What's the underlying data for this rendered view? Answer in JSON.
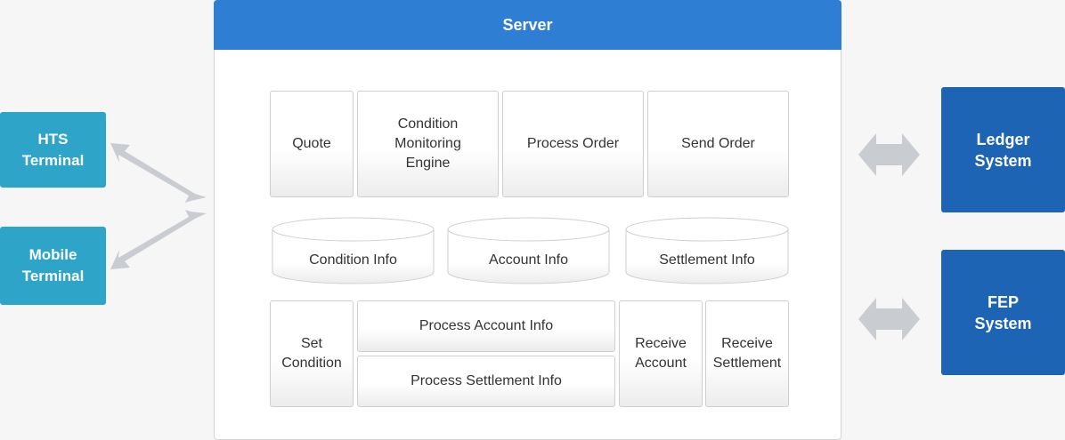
{
  "server": {
    "title": "Server"
  },
  "terminals": [
    {
      "label": "HTS\nTerminal"
    },
    {
      "label": "Mobile\nTerminal"
    }
  ],
  "externals": [
    {
      "label": "Ledger\nSystem"
    },
    {
      "label": "FEP\nSystem"
    }
  ],
  "modules": {
    "quote": "Quote",
    "condition_engine": "Condition\nMonitoring\nEngine",
    "process_order": "Process Order",
    "send_order": "Send Order",
    "set_condition": "Set\nCondition",
    "process_account_info": "Process Account Info",
    "process_settlement_info": "Process Settlement Info",
    "receive_account": "Receive\nAccount",
    "receive_settlement": "Receive\nSettlement"
  },
  "databases": [
    {
      "label": "Condition Info"
    },
    {
      "label": "Account Info"
    },
    {
      "label": "Settlement Info"
    }
  ],
  "colors": {
    "server_header": "#2e7fd4",
    "terminal": "#2ea4c9",
    "external_system": "#1d64b4",
    "arrow": "#c9ccd1"
  }
}
